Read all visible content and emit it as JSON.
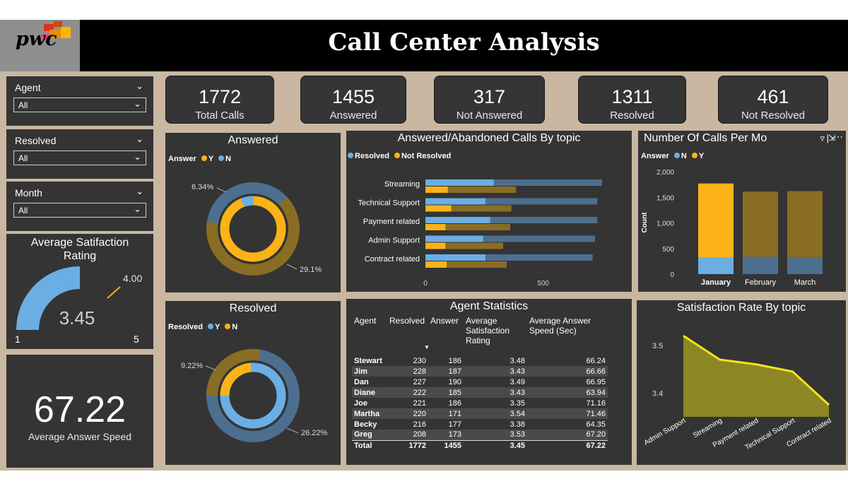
{
  "header": {
    "title": "Call Center Analysis",
    "logo": "pwc"
  },
  "slicers": [
    {
      "label": "Agent",
      "value": "All"
    },
    {
      "label": "Resolved",
      "value": "All"
    },
    {
      "label": "Month",
      "value": "All"
    }
  ],
  "gauge": {
    "title": "Average Satifaction Rating",
    "value": "3.45",
    "target": "4.00",
    "min": "1",
    "max": "5",
    "value_num": 3.45,
    "min_num": 1,
    "max_num": 5
  },
  "speed": {
    "value": "67.22",
    "label": "Average Answer Speed"
  },
  "kpis": [
    {
      "value": "1772",
      "label": "Total Calls"
    },
    {
      "value": "1455",
      "label": "Answered"
    },
    {
      "value": "317",
      "label": "Not Answered"
    },
    {
      "value": "1311",
      "label": "Resolved"
    },
    {
      "value": "461",
      "label": "Not Resolved"
    }
  ],
  "colors": {
    "blue": "#6aaee4",
    "gold": "#fbb317",
    "dark_blue": "#4d6f8f",
    "dark_gold": "#8a6d24",
    "panel": "#343434",
    "yellow": "#f1e419"
  },
  "answered": {
    "title": "Answered",
    "legend_title": "Answer",
    "legend": [
      "Y",
      "N"
    ],
    "label_small": "6.34%",
    "label_large": "29.1%"
  },
  "resolved": {
    "title": "Resolved",
    "legend_title": "Resolved",
    "legend": [
      "Y",
      "N"
    ],
    "label_small": "9.22%",
    "label_large": "26.22%"
  },
  "topic_chart": {
    "title": "Answered/Abandoned Calls By topic",
    "legend": [
      "Resolved",
      "Not Resolved"
    ]
  },
  "month_chart": {
    "title": "Number Of Calls Per Mo",
    "legend_title": "Answer",
    "legend": [
      "N",
      "Y"
    ],
    "ylabel": "Count"
  },
  "agent_stats": {
    "title": "Agent Statistics",
    "headers": [
      "Agent",
      "Resolved",
      "Answer",
      "Average Satisfaction Rating",
      "Average Answer Speed (Sec)"
    ],
    "rows": [
      [
        "Stewart",
        "230",
        "186",
        "3.48",
        "66.24"
      ],
      [
        "Jim",
        "228",
        "187",
        "3.43",
        "66.66"
      ],
      [
        "Dan",
        "227",
        "190",
        "3.49",
        "66.95"
      ],
      [
        "Diane",
        "222",
        "185",
        "3.43",
        "63.94"
      ],
      [
        "Joe",
        "221",
        "186",
        "3.35",
        "71.16"
      ],
      [
        "Martha",
        "220",
        "171",
        "3.54",
        "71.46"
      ],
      [
        "Becky",
        "216",
        "177",
        "3.38",
        "64.35"
      ],
      [
        "Greg",
        "208",
        "173",
        "3.53",
        "67.20"
      ]
    ],
    "total": [
      "Total",
      "1772",
      "1455",
      "3.45",
      "67.22"
    ]
  },
  "satisfaction_chart": {
    "title": "Satisfaction Rate By topic"
  },
  "chart_data": [
    {
      "type": "pie",
      "title": "Answered",
      "series": [
        {
          "name": "Y",
          "values": [
            64.56
          ]
        },
        {
          "name": "N",
          "values": [
            35.44
          ]
        }
      ]
    },
    {
      "type": "pie",
      "title": "Resolved",
      "series": [
        {
          "name": "Y",
          "values": [
            64.56
          ]
        },
        {
          "name": "N",
          "values": [
            35.44
          ]
        }
      ]
    },
    {
      "type": "bar",
      "title": "Answered/Abandoned Calls By topic",
      "categories": [
        "Streaming",
        "Technical Support",
        "Payment related",
        "Admin Support",
        "Contract related"
      ],
      "series": [
        {
          "name": "Resolved",
          "values": [
            290,
            255,
            275,
            245,
            255
          ]
        },
        {
          "name": "Not Resolved",
          "values": [
            95,
            110,
            85,
            85,
            90
          ]
        }
      ],
      "totals": [
        750,
        730,
        730,
        720,
        710
      ],
      "xlim": [
        0,
        780
      ],
      "xticks": [
        "0",
        "500"
      ]
    },
    {
      "type": "bar",
      "title": "Number Of Calls Per Mo",
      "categories": [
        "January",
        "February",
        "March"
      ],
      "series": [
        {
          "name": "N",
          "values": [
            320,
            340,
            330
          ]
        },
        {
          "name": "Y",
          "values": [
            1450,
            1270,
            1290
          ]
        }
      ],
      "ylim": [
        0,
        2000
      ],
      "yticks": [
        "0",
        "500",
        "1,000",
        "1,500",
        "2,000"
      ]
    },
    {
      "type": "area",
      "title": "Satisfaction Rate By topic",
      "categories": [
        "Admin Support",
        "Streaming",
        "Payment related",
        "Technical Support",
        "Contract related"
      ],
      "values": [
        3.52,
        3.47,
        3.46,
        3.445,
        3.375
      ],
      "ylim": [
        3.35,
        3.55
      ],
      "yticks": [
        "3.4",
        "3.5"
      ]
    }
  ]
}
